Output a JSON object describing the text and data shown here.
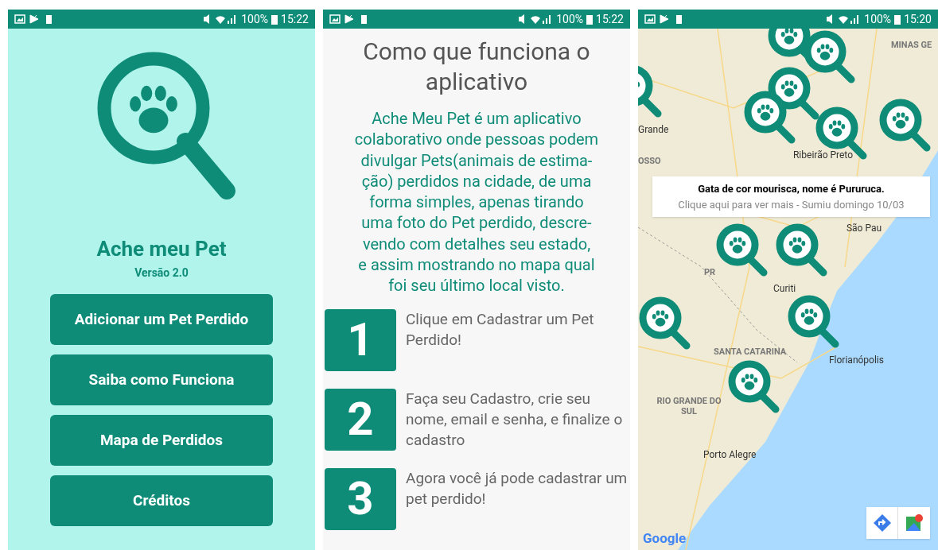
{
  "screens": [
    {
      "status_bar": {
        "battery": "100%",
        "time": "15:22"
      },
      "app_title": "Ache meu Pet",
      "version": "Versão 2.0",
      "buttons": [
        "Adicionar um Pet Perdido",
        "Saiba como Funciona",
        "Mapa de Perdidos",
        "Créditos"
      ]
    },
    {
      "status_bar": {
        "battery": "100%",
        "time": "15:22"
      },
      "title": "Como que funciona o aplicativo",
      "description_lines": [
        "Ache Meu Pet é um aplicativo",
        "colaborativo onde pessoas podem",
        "divulgar Pets(animais de estima-",
        "ção) perdidos na cidade, de uma",
        "forma simples, apenas tirando",
        "uma foto do Pet perdido, descre-",
        "vendo com detalhes seu estado,",
        "e assim mostrando no mapa qual",
        "foi seu último local visto."
      ],
      "steps": [
        {
          "number": "1",
          "text": "Clique em Cadastrar um Pet Perdido!"
        },
        {
          "number": "2",
          "text": "Faça seu Cadastro, crie seu nome, email e senha, e finalize o cadastro"
        },
        {
          "number": "3",
          "text": "Agora você já pode cadastrar um pet perdido!"
        }
      ]
    },
    {
      "status_bar": {
        "battery": "100%",
        "time": "15:20"
      },
      "map_labels": [
        {
          "text": "MINAS GE",
          "kind": "region"
        },
        {
          "text": "Grande",
          "kind": "city"
        },
        {
          "text": "OSSO",
          "kind": "region"
        },
        {
          "text": "Ribeirão Preto",
          "kind": "city"
        },
        {
          "text": "São Pau",
          "kind": "city"
        },
        {
          "text": "Curiti",
          "kind": "city"
        },
        {
          "text": "PR",
          "kind": "region"
        },
        {
          "text": "SANTA CATARINA",
          "kind": "region"
        },
        {
          "text": "Florianópolis",
          "kind": "city"
        },
        {
          "text": "RIO GRANDE DO SUL",
          "kind": "region"
        },
        {
          "text": "Porto Alegre",
          "kind": "city"
        }
      ],
      "info_window": {
        "title": "Gata de cor mourisca, nome é Pururuca.",
        "subtitle": "Clique aqui para ver mais - Sumiu domingo 10/03"
      },
      "brand": "Google"
    }
  ]
}
